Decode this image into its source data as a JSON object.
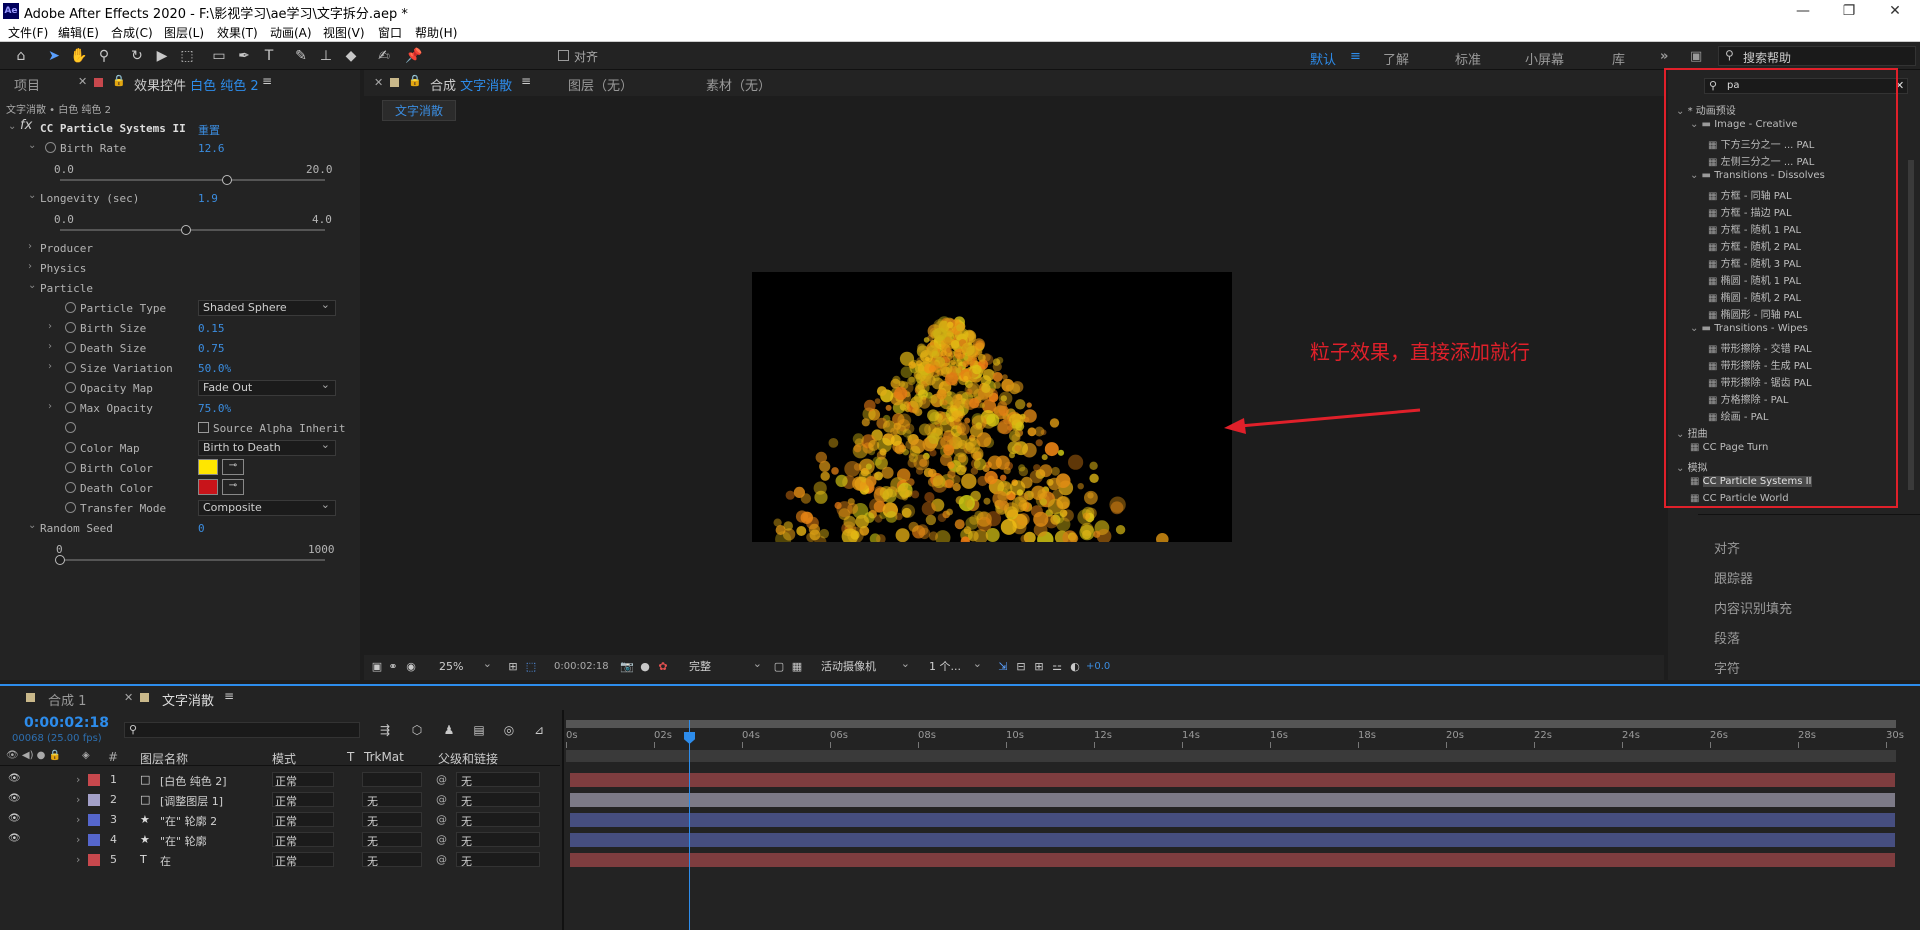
{
  "title_bar": {
    "app_icon": "Ae",
    "title": "Adobe After Effects 2020 - F:\\影视学习\\ae学习\\文字拆分.aep *"
  },
  "menu": [
    "文件(F)",
    "编辑(E)",
    "合成(C)",
    "图层(L)",
    "效果(T)",
    "动画(A)",
    "视图(V)",
    "窗口",
    "帮助(H)"
  ],
  "toolbar": {
    "align_label": "对齐",
    "workspaces": [
      "默认",
      "了解",
      "标准",
      "小屏幕",
      "库"
    ],
    "search_help": "搜索帮助"
  },
  "left_panel": {
    "tab_project": "项目",
    "tab_effects_prefix": "效果控件",
    "tab_effects_layer": "白色 纯色 2",
    "breadcrumb": "文字消散 • 白色 纯色 2",
    "effect_name": "CC Particle Systems II",
    "reset": "重置",
    "birth_rate": {
      "label": "Birth Rate",
      "value": "12.6",
      "min": "0.0",
      "max": "20.0",
      "level": 0.63
    },
    "longevity": {
      "label": "Longevity (sec)",
      "value": "1.9",
      "min": "0.0",
      "max": "4.0",
      "level": 0.475
    },
    "groups": [
      "Producer",
      "Physics",
      "Particle"
    ],
    "particle_type": {
      "label": "Particle Type",
      "value": "Shaded Sphere"
    },
    "birth_size": {
      "label": "Birth Size",
      "value": "0.15"
    },
    "death_size": {
      "label": "Death Size",
      "value": "0.75"
    },
    "size_variation": {
      "label": "Size Variation",
      "value": "50.0%"
    },
    "opacity_map": {
      "label": "Opacity Map",
      "value": "Fade Out"
    },
    "max_opacity": {
      "label": "Max Opacity",
      "value": "75.0%"
    },
    "source_alpha": "Source Alpha Inherit",
    "color_map": {
      "label": "Color Map",
      "value": "Birth to Death"
    },
    "birth_color": {
      "label": "Birth Color",
      "color": "#ffe600"
    },
    "death_color": {
      "label": "Death Color",
      "color": "#c8141a"
    },
    "transfer_mode": {
      "label": "Transfer Mode",
      "value": "Composite"
    },
    "random_seed": {
      "label": "Random Seed",
      "value": "0",
      "min": "0",
      "max": "1000",
      "level": 0.0
    }
  },
  "comp_panel": {
    "tab_comp_prefix": "合成",
    "tab_comp_name": "文字消散",
    "tab_layer": "图层（无）",
    "tab_footage": "素材（无）",
    "breadcrumb": "文字消散",
    "annotation": "粒子效果，直接添加就行",
    "footer": {
      "zoom": "25%",
      "timecode": "0:00:02:18",
      "quality": "完整",
      "camera": "活动摄像机",
      "views": "1 个...",
      "exposure": "+0.0"
    }
  },
  "right_panel": {
    "search": "pa",
    "tree": [
      {
        "text": "* 动画预设",
        "lvl": 0,
        "t": "root"
      },
      {
        "text": "Image - Creative",
        "lvl": 1,
        "t": "folder"
      },
      {
        "text": "下方三分之一 ... PAL",
        "lvl": 2,
        "t": "preset"
      },
      {
        "text": "左侧三分之一 ... PAL",
        "lvl": 2,
        "t": "preset"
      },
      {
        "text": "Transitions - Dissolves",
        "lvl": 1,
        "t": "folder"
      },
      {
        "text": "方框 - 同轴 PAL",
        "lvl": 2,
        "t": "preset"
      },
      {
        "text": "方框 - 描边 PAL",
        "lvl": 2,
        "t": "preset"
      },
      {
        "text": "方框 - 随机 1 PAL",
        "lvl": 2,
        "t": "preset"
      },
      {
        "text": "方框 - 随机 2 PAL",
        "lvl": 2,
        "t": "preset"
      },
      {
        "text": "方框 - 随机 3 PAL",
        "lvl": 2,
        "t": "preset"
      },
      {
        "text": "椭圆 - 随机 1 PAL",
        "lvl": 2,
        "t": "preset"
      },
      {
        "text": "椭圆 - 随机 2 PAL",
        "lvl": 2,
        "t": "preset"
      },
      {
        "text": "椭圆形 - 同轴 PAL",
        "lvl": 2,
        "t": "preset"
      },
      {
        "text": "Transitions - Wipes",
        "lvl": 1,
        "t": "folder"
      },
      {
        "text": "带形擦除 - 交错 PAL",
        "lvl": 2,
        "t": "preset"
      },
      {
        "text": "带形擦除 - 生成 PAL",
        "lvl": 2,
        "t": "preset"
      },
      {
        "text": "带形擦除 - 锯齿 PAL",
        "lvl": 2,
        "t": "preset"
      },
      {
        "text": "方格擦除 - PAL",
        "lvl": 2,
        "t": "preset"
      },
      {
        "text": "绘画 - PAL",
        "lvl": 2,
        "t": "preset"
      },
      {
        "text": "扭曲",
        "lvl": 0,
        "t": "cat"
      },
      {
        "text": "CC Page Turn",
        "lvl": 1,
        "t": "effect"
      },
      {
        "text": "模拟",
        "lvl": 0,
        "t": "cat"
      },
      {
        "text": "CC Particle Systems II",
        "lvl": 1,
        "t": "effect",
        "sel": true
      },
      {
        "text": "CC Particle World",
        "lvl": 1,
        "t": "effect"
      }
    ],
    "collapsed": [
      "对齐",
      "跟踪器",
      "内容识别填充",
      "段落",
      "字符"
    ]
  },
  "timeline": {
    "tab1": "合成 1",
    "tab2": "文字消散",
    "timecode": "0:00:02:18",
    "frames": "00068 (25.00 fps)",
    "cols": [
      "图层名称",
      "模式",
      "T",
      "TrkMat",
      "父级和链接"
    ],
    "ticks": [
      "0s",
      "02s",
      "04s",
      "06s",
      "08s",
      "10s",
      "12s",
      "14s",
      "16s",
      "18s",
      "20s",
      "22s",
      "24s",
      "26s",
      "28s",
      "30s"
    ],
    "playhead": 0.0925,
    "layers": [
      {
        "num": "1",
        "name": "[白色 纯色 2]",
        "mode": "正常",
        "trk": "",
        "parent": "无",
        "label": "#c7484d",
        "bar": "#7e3d3f",
        "vis": true,
        "ic": "□"
      },
      {
        "num": "2",
        "name": "[调整图层 1]",
        "mode": "正常",
        "trk": "无",
        "parent": "无",
        "label": "#a3a0c8",
        "bar": "#7c7a87",
        "vis": true,
        "ic": "□"
      },
      {
        "num": "3",
        "name": "\"在\" 轮廓 2",
        "mode": "正常",
        "trk": "无",
        "parent": "无",
        "label": "#5566cc",
        "bar": "#464e80",
        "vis": true,
        "ic": "★"
      },
      {
        "num": "4",
        "name": "\"在\" 轮廓",
        "mode": "正常",
        "trk": "无",
        "parent": "无",
        "label": "#5566cc",
        "bar": "#464e80",
        "vis": true,
        "ic": "★"
      },
      {
        "num": "5",
        "name": "在",
        "mode": "正常",
        "trk": "无",
        "parent": "无",
        "label": "#c7484d",
        "bar": "#7e3d3f",
        "vis": false,
        "ic": "T"
      }
    ]
  }
}
